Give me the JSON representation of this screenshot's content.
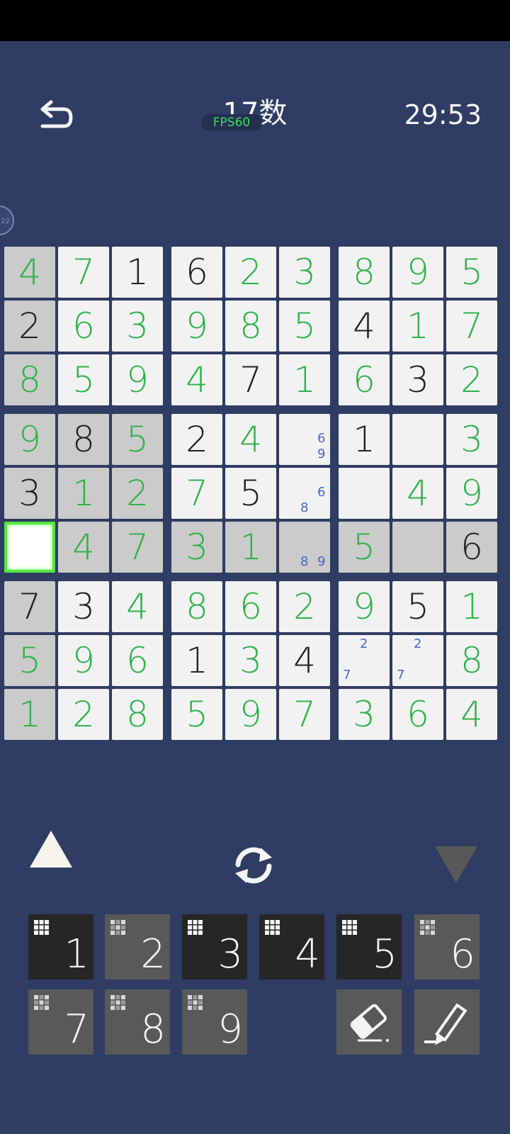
{
  "header": {
    "title": "17数",
    "fps": "FPS60",
    "timer": "29:53"
  },
  "side_badge": "22",
  "board": {
    "rows": [
      [
        [
          "4",
          "u",
          "g"
        ],
        [
          "7",
          "u",
          "w"
        ],
        [
          "1",
          "g",
          "w"
        ],
        [
          "6",
          "g",
          "w"
        ],
        [
          "2",
          "u",
          "w"
        ],
        [
          "3",
          "u",
          "w"
        ],
        [
          "8",
          "u",
          "w"
        ],
        [
          "9",
          "u",
          "w"
        ],
        [
          "5",
          "u",
          "w"
        ]
      ],
      [
        [
          "2",
          "g",
          "g"
        ],
        [
          "6",
          "u",
          "w"
        ],
        [
          "3",
          "u",
          "w"
        ],
        [
          "9",
          "u",
          "w"
        ],
        [
          "8",
          "u",
          "w"
        ],
        [
          "5",
          "u",
          "w"
        ],
        [
          "4",
          "g",
          "w"
        ],
        [
          "1",
          "u",
          "w"
        ],
        [
          "7",
          "u",
          "w"
        ]
      ],
      [
        [
          "8",
          "u",
          "g"
        ],
        [
          "5",
          "u",
          "w"
        ],
        [
          "9",
          "u",
          "w"
        ],
        [
          "4",
          "u",
          "w"
        ],
        [
          "7",
          "g",
          "w"
        ],
        [
          "1",
          "u",
          "w"
        ],
        [
          "6",
          "u",
          "w"
        ],
        [
          "3",
          "g",
          "w"
        ],
        [
          "2",
          "u",
          "w"
        ]
      ],
      [
        [
          "9",
          "u",
          "g"
        ],
        [
          "8",
          "g",
          "g"
        ],
        [
          "5",
          "u",
          "g"
        ],
        [
          "2",
          "g",
          "w"
        ],
        [
          "4",
          "u",
          "w"
        ],
        [
          "",
          "",
          "w"
        ],
        [
          "1",
          "g",
          "w"
        ],
        [
          "",
          "",
          "w"
        ],
        [
          "3",
          "u",
          "w"
        ]
      ],
      [
        [
          "3",
          "g",
          "g"
        ],
        [
          "1",
          "u",
          "g"
        ],
        [
          "2",
          "u",
          "g"
        ],
        [
          "7",
          "u",
          "w"
        ],
        [
          "5",
          "g",
          "w"
        ],
        [
          "",
          "",
          "w"
        ],
        [
          "",
          "",
          "w"
        ],
        [
          "4",
          "u",
          "w"
        ],
        [
          "9",
          "u",
          "w"
        ]
      ],
      [
        [
          "",
          "",
          "s"
        ],
        [
          "4",
          "u",
          "g"
        ],
        [
          "7",
          "u",
          "g"
        ],
        [
          "3",
          "u",
          "g"
        ],
        [
          "1",
          "u",
          "g"
        ],
        [
          "",
          "",
          "g"
        ],
        [
          "5",
          "u",
          "g"
        ],
        [
          "",
          "",
          "g"
        ],
        [
          "6",
          "g",
          "g"
        ]
      ],
      [
        [
          "7",
          "g",
          "g"
        ],
        [
          "3",
          "g",
          "w"
        ],
        [
          "4",
          "u",
          "w"
        ],
        [
          "8",
          "u",
          "w"
        ],
        [
          "6",
          "u",
          "w"
        ],
        [
          "2",
          "u",
          "w"
        ],
        [
          "9",
          "u",
          "w"
        ],
        [
          "5",
          "g",
          "w"
        ],
        [
          "1",
          "u",
          "w"
        ]
      ],
      [
        [
          "5",
          "u",
          "g"
        ],
        [
          "9",
          "u",
          "w"
        ],
        [
          "6",
          "u",
          "w"
        ],
        [
          "1",
          "g",
          "w"
        ],
        [
          "3",
          "u",
          "w"
        ],
        [
          "4",
          "g",
          "w"
        ],
        [
          "",
          "",
          "w"
        ],
        [
          "",
          "",
          "w"
        ],
        [
          "8",
          "u",
          "w"
        ]
      ],
      [
        [
          "1",
          "u",
          "g"
        ],
        [
          "2",
          "u",
          "w"
        ],
        [
          "8",
          "u",
          "w"
        ],
        [
          "5",
          "u",
          "w"
        ],
        [
          "9",
          "u",
          "w"
        ],
        [
          "7",
          "u",
          "w"
        ],
        [
          "3",
          "u",
          "w"
        ],
        [
          "6",
          "u",
          "w"
        ],
        [
          "4",
          "u",
          "w"
        ]
      ]
    ],
    "notes": [
      {
        "r": 3,
        "c": 5,
        "digits": [
          "6",
          "9"
        ]
      },
      {
        "r": 4,
        "c": 5,
        "digits": [
          "6",
          "8"
        ]
      },
      {
        "r": 5,
        "c": 5,
        "digits": [
          "8",
          "9"
        ]
      },
      {
        "r": 7,
        "c": 6,
        "digits": [
          "2",
          "7"
        ]
      },
      {
        "r": 7,
        "c": 7,
        "digits": [
          "2",
          "7"
        ]
      }
    ]
  },
  "keypad": [
    {
      "label": "1",
      "style": "dark"
    },
    {
      "label": "2",
      "style": "light"
    },
    {
      "label": "3",
      "style": "dark"
    },
    {
      "label": "4",
      "style": "dark"
    },
    {
      "label": "5",
      "style": "dark"
    },
    {
      "label": "6",
      "style": "light"
    },
    {
      "label": "7",
      "style": "light"
    },
    {
      "label": "8",
      "style": "light"
    },
    {
      "label": "9",
      "style": "light"
    }
  ],
  "colors": {
    "background": "#2f3c63",
    "user_digit": "#2fb34a",
    "given_digit": "#222222",
    "note": "#4c63c9",
    "selection": "#55e640"
  },
  "icons": {
    "back": "undo-arrow-icon",
    "up": "triangle-up-icon",
    "refresh": "refresh-icon",
    "down": "triangle-down-icon",
    "eraser": "eraser-icon",
    "pencil": "pencil-icon"
  }
}
